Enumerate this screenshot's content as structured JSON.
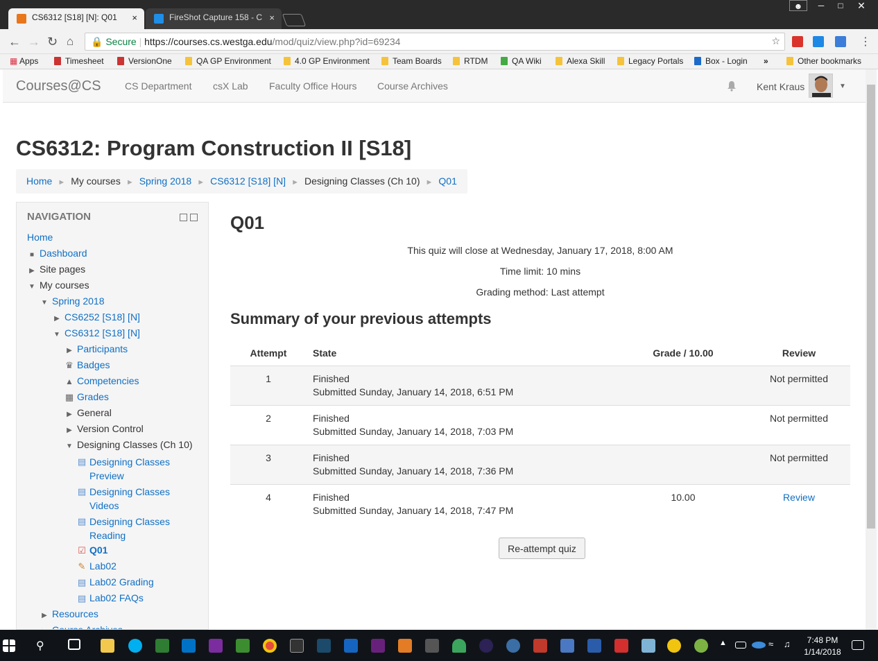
{
  "browser": {
    "tabs": [
      {
        "label": "CS6312 [S18] [N]: Q01",
        "close": "×"
      },
      {
        "label": "FireShot Capture 158 - C",
        "close": "×"
      }
    ],
    "url_secure": "Secure",
    "url_host": "https://courses.cs.westga.edu",
    "url_path": "/mod/quiz/view.php?id=69234",
    "bookmarks": [
      "Apps",
      "Timesheet",
      "VersionOne",
      "QA GP Environment",
      "4.0 GP Environment",
      "Team Boards",
      "RTDM",
      "QA Wiki",
      "Alexa Skill",
      "Legacy Portals",
      "Box - Login"
    ],
    "bookmarks_more": "»",
    "other_bookmarks": "Other bookmarks"
  },
  "site": {
    "brand": "Courses@CS",
    "nav_links": [
      "CS Department",
      "csX Lab",
      "Faculty Office Hours",
      "Course Archives"
    ],
    "user_name": "Kent Kraus"
  },
  "page": {
    "course_title": "CS6312: Program Construction II [S18]",
    "breadcrumb": [
      "Home",
      "My courses",
      "Spring 2018",
      "CS6312 [S18] [N]",
      "Designing Classes (Ch 10)",
      "Q01"
    ],
    "breadcrumb_sep": "►"
  },
  "navigation": {
    "heading": "NAVIGATION",
    "items": [
      {
        "label": "Home"
      },
      {
        "label": "Dashboard"
      },
      {
        "label": "Site pages"
      },
      {
        "label": "My courses"
      },
      {
        "label": "Spring 2018"
      },
      {
        "label": "CS6252 [S18] [N]"
      },
      {
        "label": "CS6312 [S18] [N]"
      },
      {
        "label": "Participants"
      },
      {
        "label": "Badges"
      },
      {
        "label": "Competencies"
      },
      {
        "label": "Grades"
      },
      {
        "label": "General"
      },
      {
        "label": "Version Control"
      },
      {
        "label": "Designing Classes (Ch 10)"
      },
      {
        "label": "Designing Classes",
        "label2": "Preview"
      },
      {
        "label": "Designing Classes",
        "label2": "Videos"
      },
      {
        "label": "Designing Classes",
        "label2": "Reading"
      },
      {
        "label": "Q01"
      },
      {
        "label": "Lab02"
      },
      {
        "label": "Lab02 Grading"
      },
      {
        "label": "Lab02 FAQs"
      },
      {
        "label": "Resources"
      },
      {
        "label": "Course Archives"
      }
    ]
  },
  "quiz": {
    "heading": "Q01",
    "close_info": "This quiz will close at Wednesday, January 17, 2018, 8:00 AM",
    "time_limit": "Time limit: 10 mins",
    "grading_method": "Grading method: Last attempt",
    "summary_heading": "Summary of your previous attempts",
    "columns": [
      "Attempt",
      "State",
      "Grade / 10.00",
      "Review"
    ],
    "attempts": [
      {
        "attempt": "1",
        "state": "Finished",
        "submitted": "Submitted Sunday, January 14, 2018, 6:51 PM",
        "grade": "",
        "review": "Not permitted"
      },
      {
        "attempt": "2",
        "state": "Finished",
        "submitted": "Submitted Sunday, January 14, 2018, 7:03 PM",
        "grade": "",
        "review": "Not permitted"
      },
      {
        "attempt": "3",
        "state": "Finished",
        "submitted": "Submitted Sunday, January 14, 2018, 7:36 PM",
        "grade": "",
        "review": "Not permitted"
      },
      {
        "attempt": "4",
        "state": "Finished",
        "submitted": "Submitted Sunday, January 14, 2018, 7:47 PM",
        "grade": "10.00",
        "review": "Review"
      }
    ],
    "reattempt_label": "Re-attempt quiz"
  },
  "taskbar": {
    "time": "7:48 PM",
    "date": "1/14/2018"
  },
  "colors": {
    "link": "#0f6fc5",
    "navbar_bg": "#f7f7f7",
    "taskbar_bg": "#101419",
    "chrome_frame": "#2a2a2a"
  }
}
